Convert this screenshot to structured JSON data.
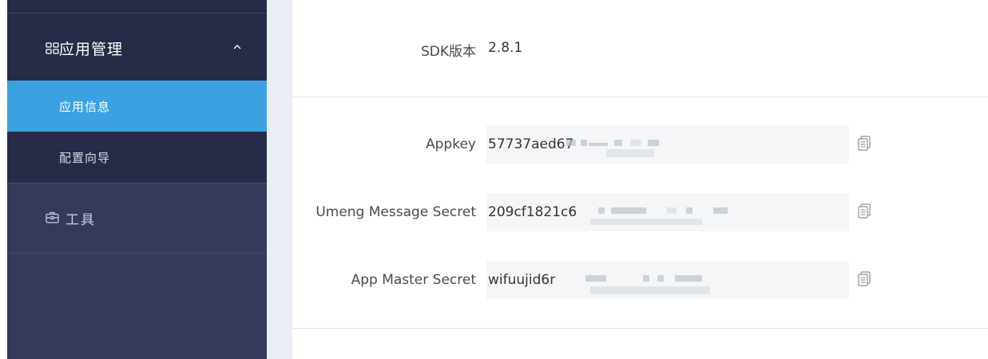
{
  "sidebar": {
    "section": {
      "label": "应用管理",
      "icon": "grid-icon",
      "chevron": "chevron-up-icon"
    },
    "items": [
      {
        "label": "应用信息",
        "active": true
      },
      {
        "label": "配置向导",
        "active": false
      }
    ],
    "tools": {
      "label": "工具",
      "icon": "briefcase-icon"
    }
  },
  "main": {
    "sdk": {
      "label": "SDK版本",
      "value": "2.8.1"
    },
    "keys": [
      {
        "label": "Appkey",
        "value": "57737aed67",
        "copy_icon": "copy-icon"
      },
      {
        "label": "Umeng Message Secret",
        "value": "209cf1821c6",
        "copy_icon": "copy-icon"
      },
      {
        "label": "App Master Secret",
        "value": "wifuujid6r",
        "copy_icon": "copy-icon"
      }
    ]
  },
  "colors": {
    "sidebar_bg": "#353a5b",
    "sidebar_dark": "#262b47",
    "active": "#3ba1e0",
    "gap": "#e9eef5",
    "field_bg": "#f4f6f8"
  }
}
